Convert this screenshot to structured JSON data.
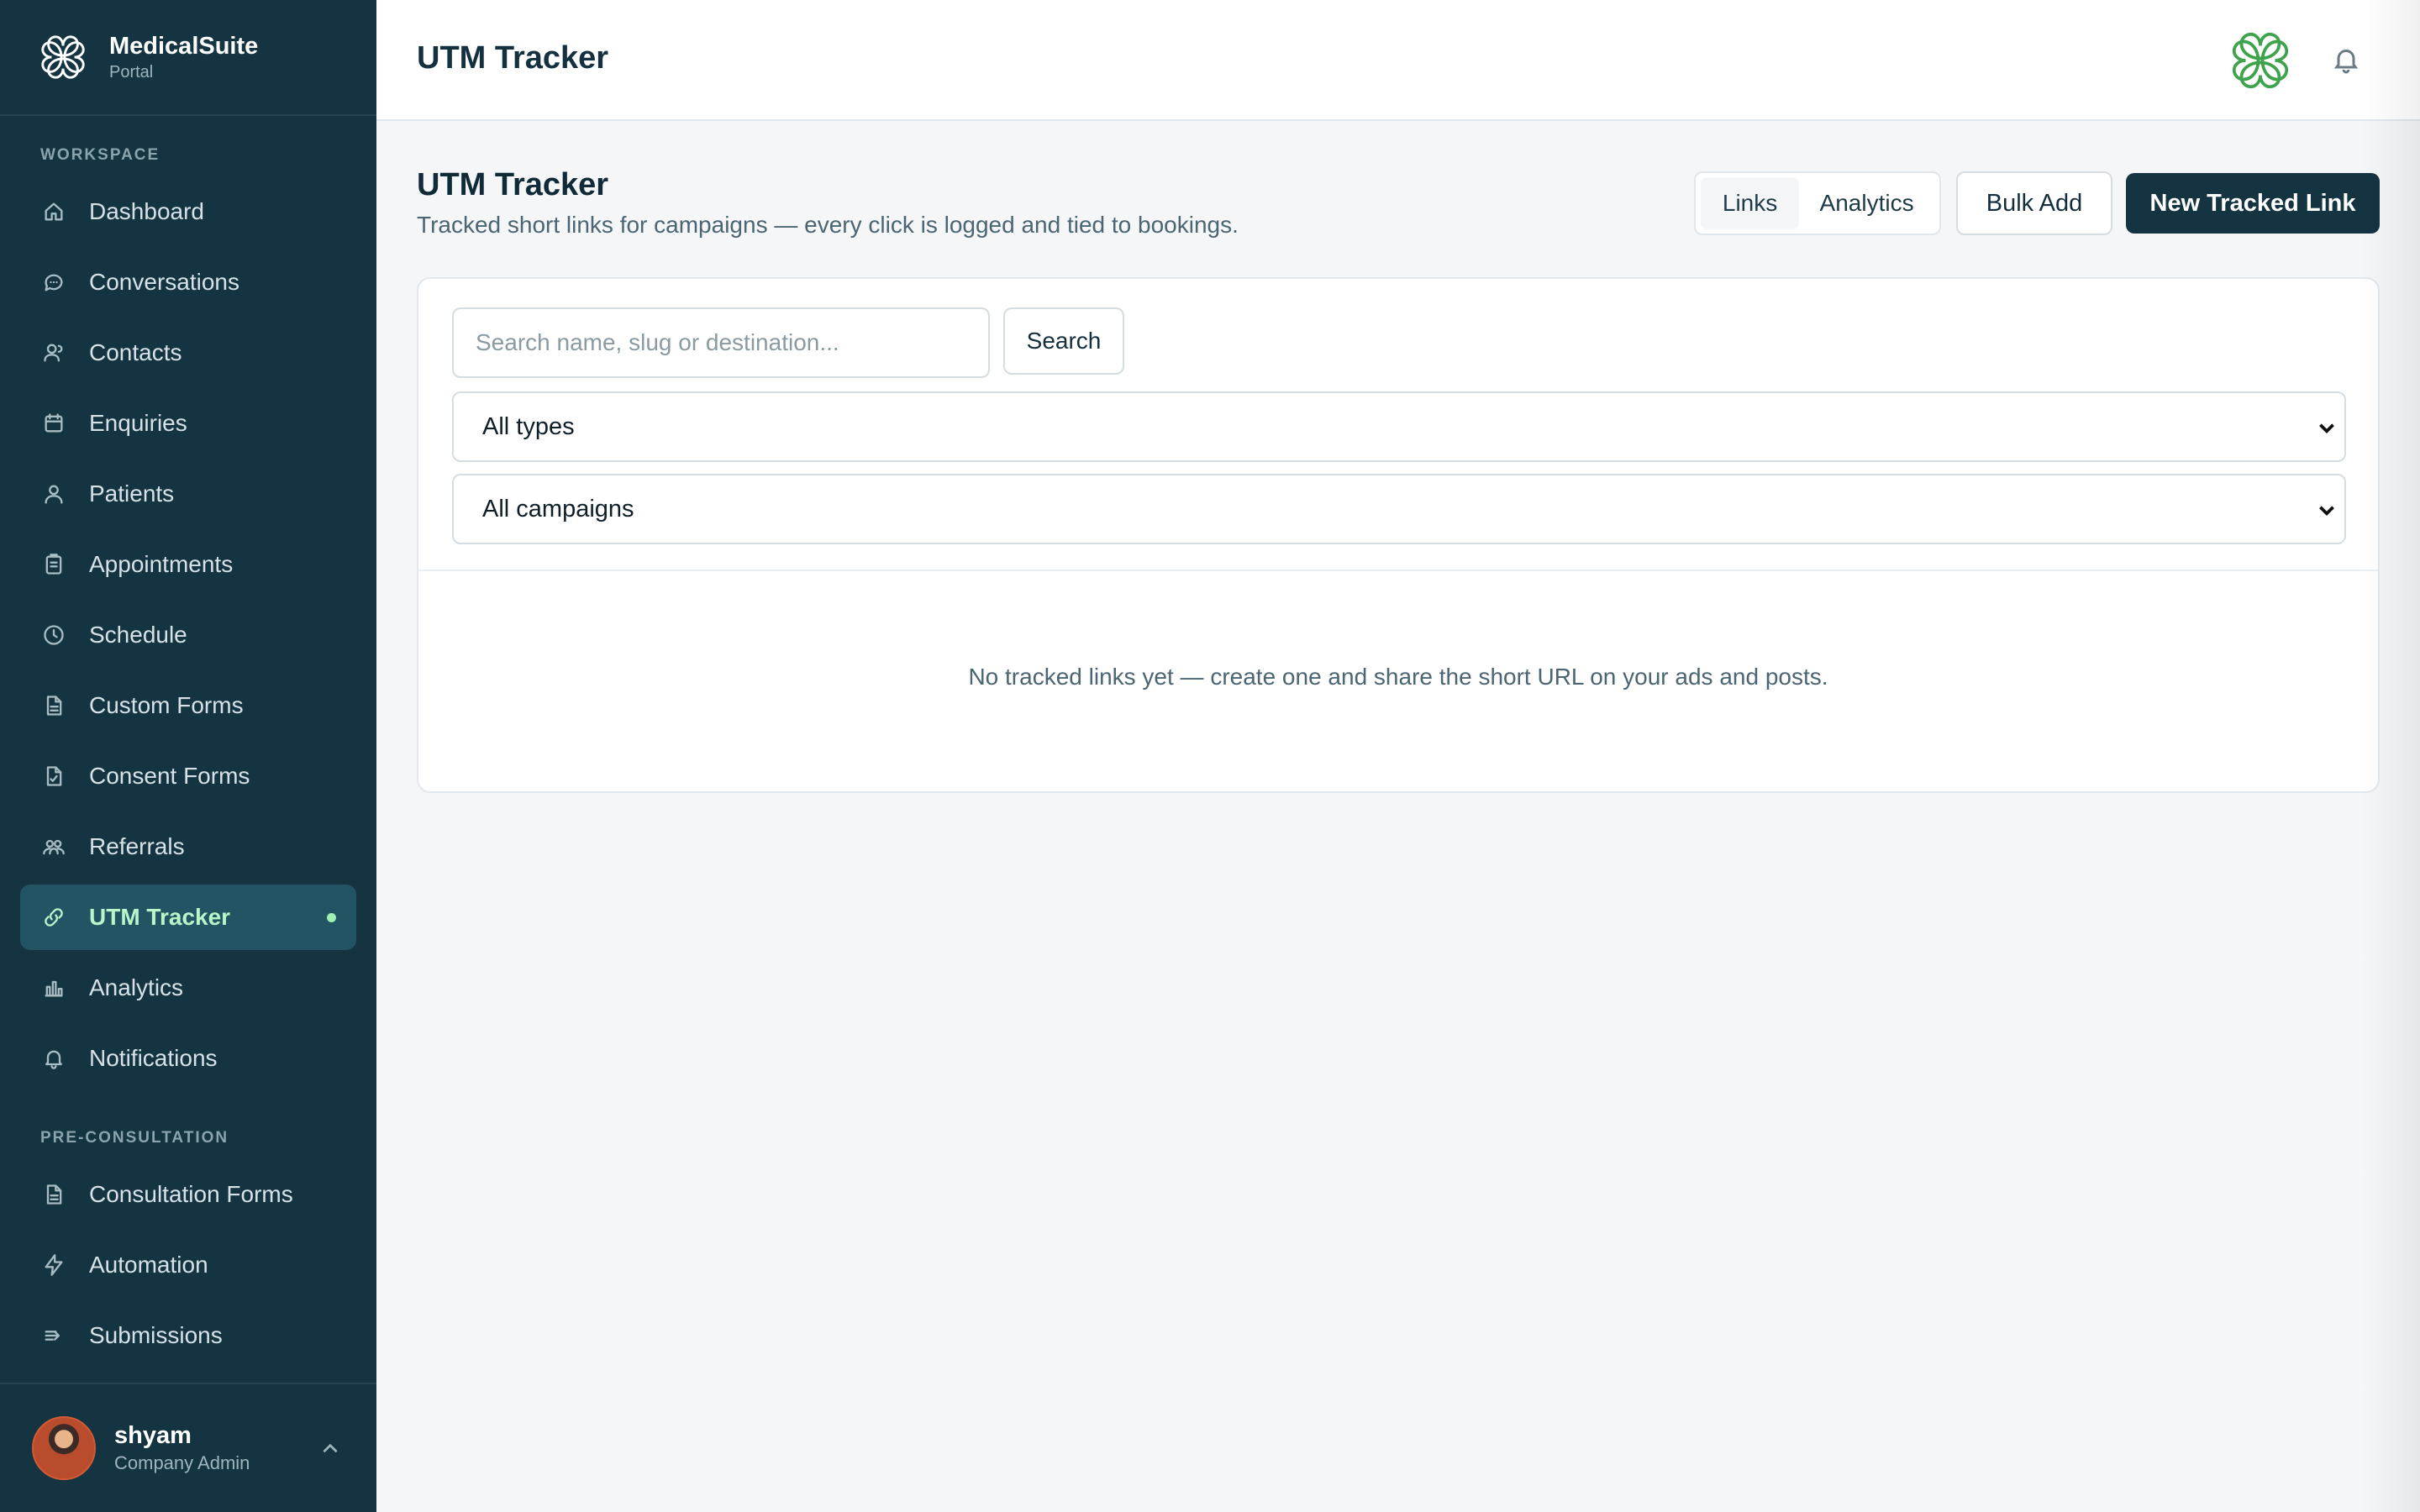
{
  "brand": {
    "title": "MedicalSuite",
    "subtitle": "Portal"
  },
  "sidebar": {
    "section_workspace": "WORKSPACE",
    "workspace_items": [
      {
        "label": "Dashboard",
        "icon": "home-icon"
      },
      {
        "label": "Conversations",
        "icon": "chat-icon"
      },
      {
        "label": "Contacts",
        "icon": "contacts-icon"
      },
      {
        "label": "Enquiries",
        "icon": "calendar-icon"
      },
      {
        "label": "Patients",
        "icon": "user-icon"
      },
      {
        "label": "Appointments",
        "icon": "clipboard-icon"
      },
      {
        "label": "Schedule",
        "icon": "clock-icon"
      },
      {
        "label": "Custom Forms",
        "icon": "document-icon"
      },
      {
        "label": "Consent Forms",
        "icon": "document-check-icon"
      },
      {
        "label": "Referrals",
        "icon": "users-icon"
      },
      {
        "label": "UTM Tracker",
        "icon": "link-icon",
        "active": true
      },
      {
        "label": "Analytics",
        "icon": "bar-chart-icon"
      },
      {
        "label": "Notifications",
        "icon": "bell-icon"
      }
    ],
    "section_preconsult": "PRE-CONSULTATION",
    "preconsult_items": [
      {
        "label": "Consultation Forms",
        "icon": "document-icon"
      },
      {
        "label": "Automation",
        "icon": "lightning-icon"
      },
      {
        "label": "Submissions",
        "icon": "send-icon"
      }
    ]
  },
  "user": {
    "name": "shyam",
    "role": "Company Admin"
  },
  "topbar": {
    "title": "UTM Tracker"
  },
  "page": {
    "title": "UTM Tracker",
    "subtitle": "Tracked short links for campaigns — every click is logged and tied to bookings."
  },
  "toolbar": {
    "tab_links": "Links",
    "tab_analytics": "Analytics",
    "bulk_add": "Bulk Add",
    "new_link": "New Tracked Link"
  },
  "filters": {
    "search_placeholder": "Search name, slug or destination...",
    "search_button": "Search",
    "type_selected": "All types",
    "campaign_selected": "All campaigns"
  },
  "empty_state": "No tracked links yet — create one and share the short URL on your ads and posts.",
  "colors": {
    "sidebar_bg": "#143442",
    "active_item_bg": "#235464",
    "active_item_text": "#b8f5c8",
    "primary_button": "#143442",
    "clover_green": "#3fa34d"
  }
}
